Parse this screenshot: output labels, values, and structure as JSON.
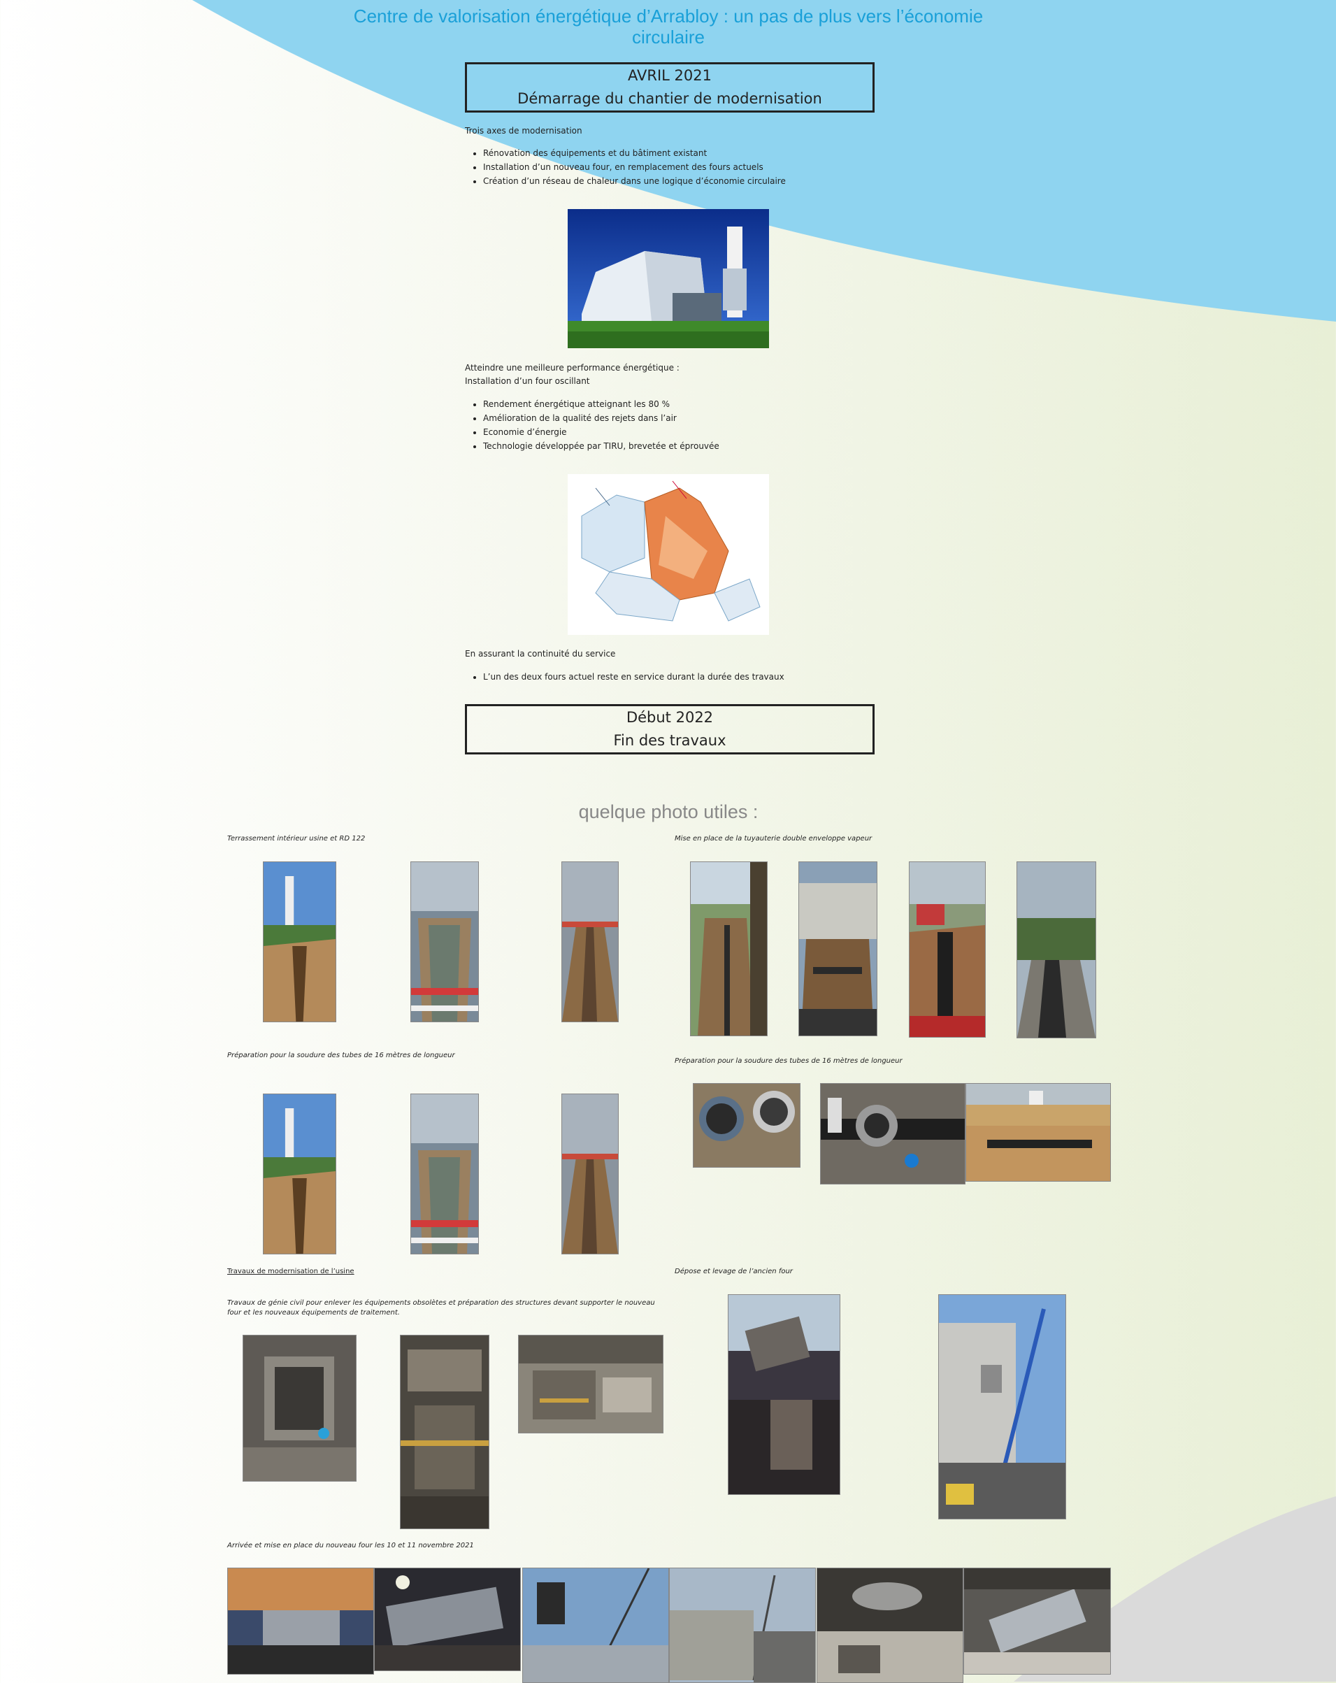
{
  "title": "Centre de valorisation énergétique d’Arrabloy : un pas de plus vers l’économie circulaire",
  "box1": {
    "line1": "AVRIL 2021",
    "line2": "Démarrage du chantier de modernisation"
  },
  "section1": {
    "heading": "Trois axes de modernisation",
    "items": [
      "Rénovation des équipements et du bâtiment existant",
      "Installation d’un nouveau four, en remplacement des fours actuels",
      "Création d’un réseau de chaleur dans une logique d’économie circulaire"
    ]
  },
  "section2": {
    "heading1": "Atteindre une meilleure performance énergétique :",
    "heading2": "Installation d’un four oscillant",
    "items": [
      "Rendement énergétique atteignant les 80 %",
      "Amélioration de la qualité des rejets dans l’air",
      "Economie d’énergie",
      "Technologie développée par TIRU, brevetée et éprouvée"
    ]
  },
  "section3": {
    "heading": "En assurant la continuité du service",
    "items": [
      "L’un des deux fours actuel reste en service durant la durée des travaux"
    ]
  },
  "box2": {
    "line1": "Début 2022",
    "line2": "Fin des travaux"
  },
  "photos": {
    "heading": "quelque photo utiles :",
    "cap_terrassement": "Terrassement intérieur usine et RD 122",
    "cap_tuyauterie": "Mise en place de la tuyauterie double enveloppe vapeur",
    "cap_soudure_left": "Préparation pour la soudure des tubes de 16 mètres de longueur",
    "cap_soudure_right": "Préparation pour la soudure des tubes de 16 mètres de longueur",
    "cap_travaux_title": "Travaux de modernisation de l’usine",
    "cap_travaux_desc": "Travaux de génie civil pour enlever les équipements obsolètes et préparation des structures devant supporter le nouveau four et les nouveaux équipements de traitement.",
    "cap_depose": "Dépose et levage de l’ancien four",
    "cap_arrivee": "Arrivée et mise en place du nouveau four les 10 et 11 novembre 2021"
  },
  "colors": {
    "title": "#1aa0d8",
    "sky_band": "#8fd4f0",
    "grey_band": "#d8d8d8"
  }
}
